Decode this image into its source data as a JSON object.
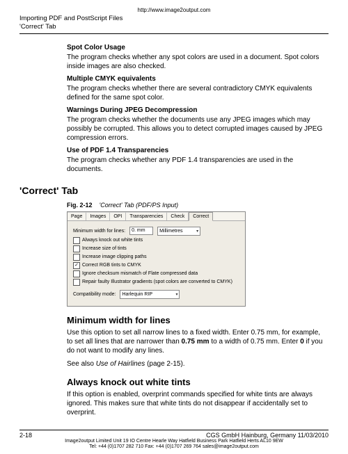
{
  "meta": {
    "url": "http://www.image2output.com",
    "headerLine1": "Importing PDF and PostScript Files",
    "headerLine2": "'Correct' Tab"
  },
  "sections": {
    "spot": {
      "title": "Spot Color Usage",
      "body": "The program checks whether any spot colors are used in a document. Spot colors inside images are also checked."
    },
    "cmyk": {
      "title": "Multiple CMYK equivalents",
      "body": "The program checks whether there are several contradictory CMYK equivalents defined for the same spot color."
    },
    "jpeg": {
      "title": "Warnings During JPEG Decompression",
      "body": "The program checks whether the documents use any JPEG images which may possibly be corrupted. This allows you to detect corrupted images caused by JPEG compression errors."
    },
    "pdftrans": {
      "title": "Use of PDF 1.4 Transparencies",
      "body": "The program checks whether any PDF 1.4 transparencies are used in the documents."
    }
  },
  "tabTitle": "'Correct' Tab",
  "figure": {
    "no": "Fig. 2-12",
    "desc": "'Correct' Tab (PDF/PS Input)"
  },
  "dialog": {
    "tabs": [
      "Page",
      "Images",
      "OPI",
      "Transparencies",
      "Check",
      "Correct"
    ],
    "minWidthLabel": "Minimum width for lines:",
    "minWidthValue": "0. mm",
    "minWidthUnit": "Millimetres",
    "checks": [
      {
        "checked": false,
        "label": "Always knock out white tints"
      },
      {
        "checked": false,
        "label": "Increase size of tints"
      },
      {
        "checked": false,
        "label": "Increase image clipping paths"
      },
      {
        "checked": true,
        "label": "Correct RGB tints to CMYK"
      },
      {
        "checked": false,
        "label": "Ignore checksum mismatch of Flate compressed data"
      },
      {
        "checked": false,
        "label": "Repair faulty Illustrator gradients (spot colors are converted to CMYK)"
      }
    ],
    "compatLabel": "Compatibility mode:",
    "compatValue": "Harlequin RIP"
  },
  "min": {
    "title": "Minimum width for lines",
    "p1a": "Use this option to set all narrow lines to a fixed width. Enter 0.75 mm, for example, to set all lines that are narrower than ",
    "p1b": "0.75 mm",
    "p1c": " to a width of 0.75 mm. Enter ",
    "p1d": "0",
    "p1e": " if you do not want to modify any lines.",
    "p2a": "See also ",
    "p2link": "Use of Hairlines",
    "p2b": " (page 2-15)."
  },
  "knockout": {
    "title": "Always knock out white tints",
    "body": "If this option is enabled, overprint commands specified for white tints are always ignored. This makes sure that white tints do not disappear if accidentally set to overprint."
  },
  "footer": {
    "pageno": "2-18",
    "right": "CGS GmbH   Hainburg, Germany   11/03/2010",
    "tiny1": "Image2output Limited  Unit 19 IO Centre Hearle Way Hatfield Business Park Hatfield Herts AL10 9EW",
    "tiny2": "Tel: +44 (0)1707 282 710 Fax: +44 (0)1707 269 764 sales@image2output.com"
  }
}
